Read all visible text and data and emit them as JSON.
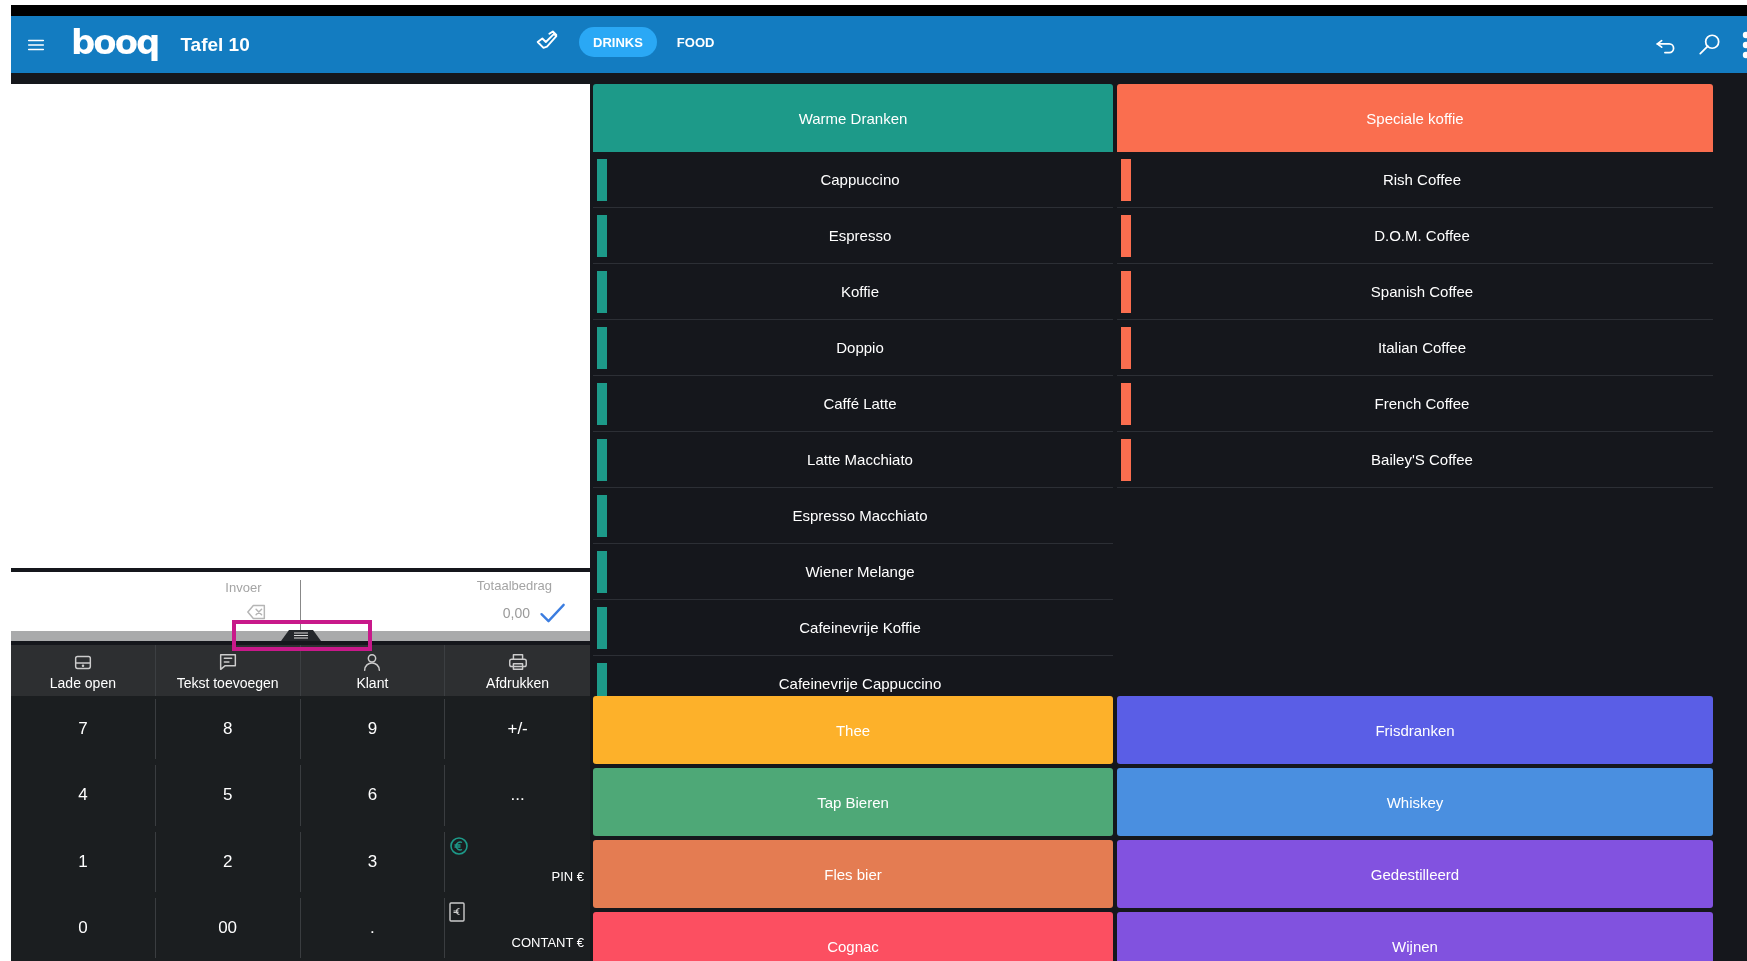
{
  "header": {
    "logo": "booq",
    "title": "Tafel 10",
    "tabs": [
      {
        "label": "DRINKS",
        "selected": true
      },
      {
        "label": "FOOD",
        "selected": false
      }
    ]
  },
  "order": {
    "input_label": "Invoer",
    "total_label": "Totaalbedrag",
    "total": "0,00",
    "handle_highlighted": true
  },
  "actions": [
    {
      "label": "Lade open",
      "kind": "drawer"
    },
    {
      "label": "Tekst toevoegen",
      "kind": "message"
    },
    {
      "label": "Klant",
      "kind": "person"
    },
    {
      "label": "Afdrukken",
      "kind": "printer"
    }
  ],
  "keypad": [
    {
      "label": "7",
      "kind": "key"
    },
    {
      "label": "8",
      "kind": "key"
    },
    {
      "label": "9",
      "kind": "key"
    },
    {
      "label": "+/-",
      "kind": "key"
    },
    {
      "label": "4",
      "kind": "key"
    },
    {
      "label": "5",
      "kind": "key"
    },
    {
      "label": "6",
      "kind": "key"
    },
    {
      "label": "...",
      "kind": "key"
    },
    {
      "label": "1",
      "kind": "key"
    },
    {
      "label": "2",
      "kind": "key"
    },
    {
      "label": "3",
      "kind": "key"
    },
    {
      "label": "PIN €",
      "kind": "card"
    },
    {
      "label": "0",
      "kind": "key"
    },
    {
      "label": "00",
      "kind": "key"
    },
    {
      "label": ".",
      "kind": "key"
    },
    {
      "label": "CONTANT €",
      "kind": "cash"
    }
  ],
  "open_categories": [
    {
      "title": "Warme Dranken",
      "color": "#1d9a89",
      "items": [
        "Cappuccino",
        "Espresso",
        "Koffie",
        "Doppio",
        "Caffé Latte",
        "Latte Macchiato",
        "Espresso Macchiato",
        "Wiener Melange",
        "Cafeinevrije Koffie",
        "Cafeinevrije Cappuccino"
      ]
    },
    {
      "title": "Speciale koffie",
      "color": "#fa6e4f",
      "items": [
        "Rish Coffee",
        "D.O.M. Coffee",
        "Spanish Coffee",
        "Italian Coffee",
        "French Coffee",
        "Bailey'S Coffee"
      ]
    }
  ],
  "categories": [
    {
      "label": "Thee",
      "color": "#fdb12a"
    },
    {
      "label": "Frisdranken",
      "color": "#5a5ee6"
    },
    {
      "label": "Tap Bieren",
      "color": "#4ea877"
    },
    {
      "label": "Whiskey",
      "color": "#4a8fe0"
    },
    {
      "label": "Fles bier",
      "color": "#e47c52"
    },
    {
      "label": "Gedestilleerd",
      "color": "#8252e0"
    },
    {
      "label": "Cognac",
      "color": "#fc4f61"
    },
    {
      "label": "Wijnen",
      "color": "#8152df"
    }
  ]
}
